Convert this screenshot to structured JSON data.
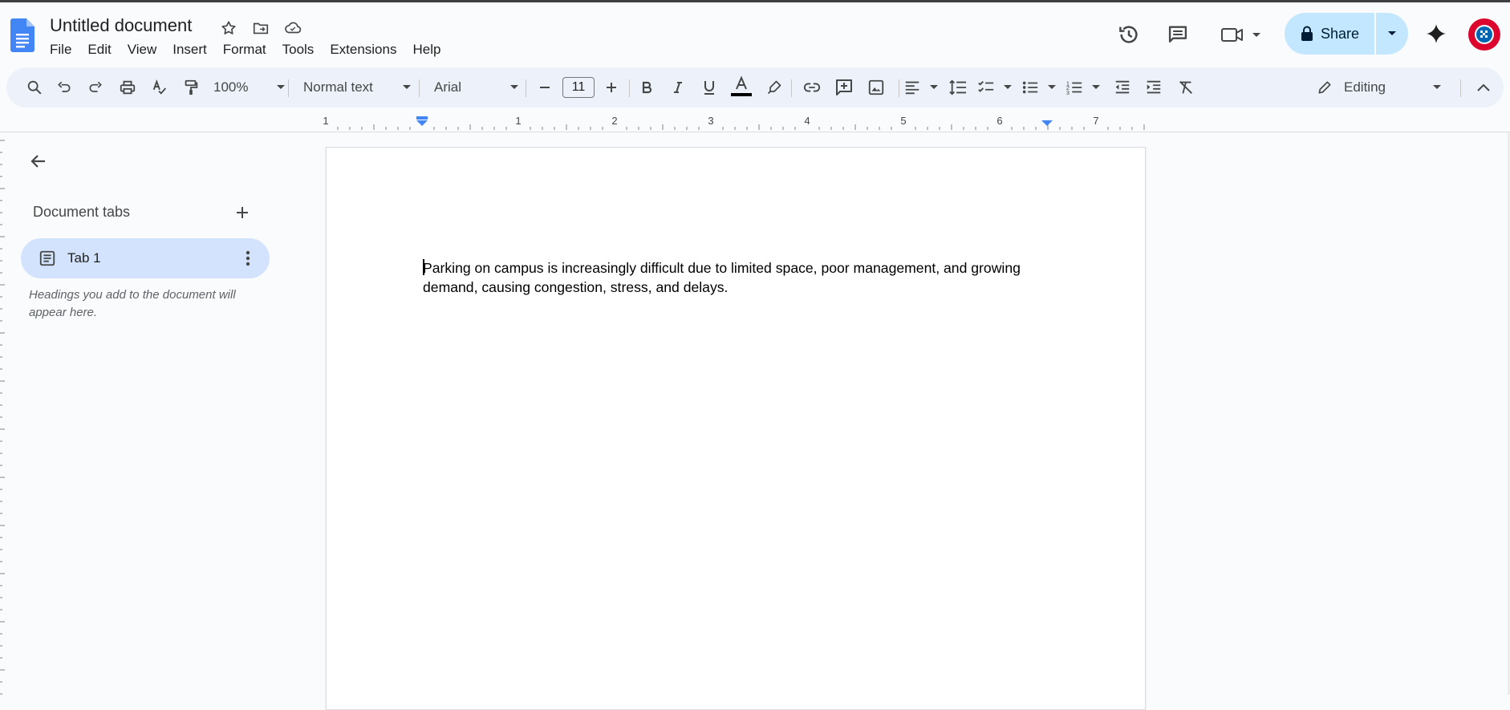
{
  "document": {
    "title": "Untitled document",
    "body_text": "Parking on campus is increasingly difficult due to limited space, poor management, and growing demand, causing congestion, stress, and delays."
  },
  "menu": [
    "File",
    "Edit",
    "View",
    "Insert",
    "Format",
    "Tools",
    "Extensions",
    "Help"
  ],
  "share": {
    "label": "Share"
  },
  "toolbar": {
    "zoom": "100%",
    "style": "Normal text",
    "font": "Arial",
    "font_size": "11",
    "mode": "Editing"
  },
  "ruler": {
    "labels": [
      "1",
      "1",
      "2",
      "3",
      "4",
      "5",
      "6",
      "7"
    ]
  },
  "sidebar": {
    "title": "Document tabs",
    "tabs": [
      {
        "label": "Tab 1"
      }
    ],
    "hint": "Headings you add to the document will appear here."
  },
  "colors": {
    "accent": "#0b57d0",
    "share_bg": "#c2e7ff",
    "toolbar_bg": "#edf2fa",
    "active_tab_bg": "#d3e3fd",
    "text_color_bar": "#000000"
  }
}
